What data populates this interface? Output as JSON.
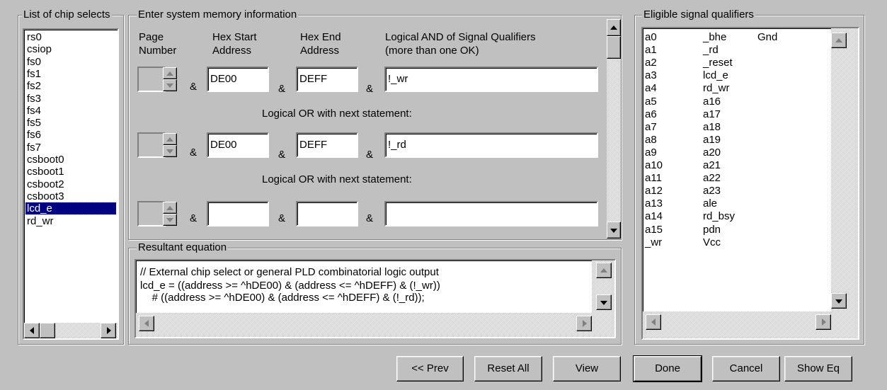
{
  "chip_selects": {
    "title": "List of chip selects",
    "items": [
      "rs0",
      "csiop",
      "fs0",
      "fs1",
      "fs2",
      "fs3",
      "fs4",
      "fs5",
      "fs6",
      "fs7",
      "csboot0",
      "csboot1",
      "csboot2",
      "csboot3",
      "lcd_e",
      "rd_wr"
    ],
    "selected_index": 14
  },
  "memory": {
    "title": "Enter system memory information",
    "headers": {
      "page_line1": "Page",
      "page_line2": "Number",
      "start_line1": "Hex Start",
      "start_line2": "Address",
      "end_line1": "Hex End",
      "end_line2": "Address",
      "and_line1": "Logical AND of Signal Qualifiers",
      "and_line2": "(more than one OK)"
    },
    "amp": "&",
    "or_label": "Logical OR with next statement:",
    "rows": [
      {
        "start": "DE00",
        "end": "DEFF",
        "qualifiers": "!_wr"
      },
      {
        "start": "DE00",
        "end": "DEFF",
        "qualifiers": "!_rd"
      },
      {
        "start": "",
        "end": "",
        "qualifiers": ""
      }
    ]
  },
  "equation": {
    "title": "Resultant equation",
    "lines": [
      "// External chip select or general PLD combinatorial logic output",
      "lcd_e = ((address >= ^hDE00) & (address <= ^hDEFF) & (!_wr))",
      "    # ((address >= ^hDE00) & (address <= ^hDEFF) & (!_rd));"
    ]
  },
  "qualifiers": {
    "title": "Eligible signal qualifiers",
    "col1": [
      "a0",
      "a1",
      "a2",
      "a3",
      "a4",
      "a5",
      "a6",
      "a7",
      "a8",
      "a9",
      "a10",
      "a11",
      "a12",
      "a13",
      "a14",
      "a15",
      "_wr"
    ],
    "col2": [
      "_bhe",
      "_rd",
      "_reset",
      "lcd_e",
      "rd_wr",
      "a16",
      "a17",
      "a18",
      "a19",
      "a20",
      "a21",
      "a22",
      "a23",
      "ale",
      "rd_bsy",
      "pdn",
      "Vcc"
    ],
    "col3": [
      "Gnd"
    ]
  },
  "buttons": {
    "prev": "<< Prev",
    "reset_all": "Reset All",
    "view": "View",
    "done": "Done",
    "cancel": "Cancel",
    "show_eq": "Show Eq"
  },
  "colors": {
    "face": "#c0c0c0",
    "selection": "#000080"
  }
}
